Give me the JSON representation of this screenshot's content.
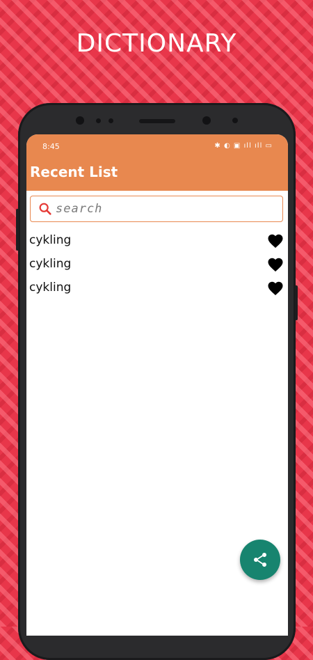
{
  "promo": {
    "title": "DICTIONARY"
  },
  "status_bar": {
    "time": "8:45",
    "icons": "✱ ◐ ▣ ıll ıll ▭"
  },
  "app_bar": {
    "title": "Recent List"
  },
  "search": {
    "placeholder": "search",
    "value": ""
  },
  "recent_list": {
    "items": [
      {
        "word": "cykling",
        "favorite": true
      },
      {
        "word": "cykling",
        "favorite": true
      },
      {
        "word": "cykling",
        "favorite": true
      }
    ]
  },
  "icons": {
    "search": "search-icon",
    "favorite": "heart-icon",
    "share": "share-icon"
  },
  "colors": {
    "background": "#e8364a",
    "app_bar": "#e8884f",
    "fab": "#17846f",
    "search_icon": "#e53935"
  }
}
